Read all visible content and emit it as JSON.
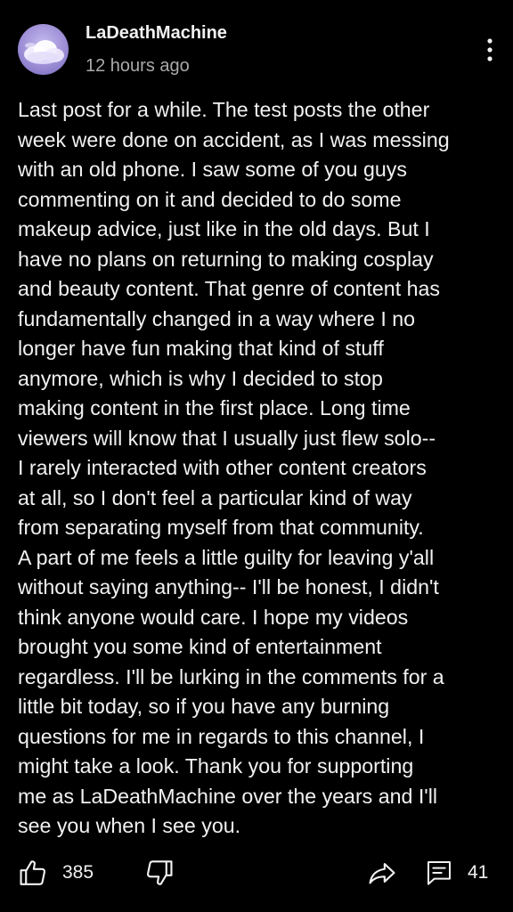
{
  "post": {
    "author": "LaDeathMachine",
    "timestamp": "12 hours ago",
    "body_lines": [
      "Last post for a while. The test posts the other",
      "week were done on accident, as I was messing",
      "with an old phone. I saw some of you guys",
      "commenting on it and decided to do some",
      "makeup advice, just like in the old days. But I",
      "have no plans on returning to making cosplay",
      "and beauty content. That genre of content has",
      "fundamentally changed in a way where I no",
      "longer have fun making that kind of stuff",
      "anymore, which is why I decided to stop",
      "making content in the first place. Long time",
      "viewers will know that I usually just flew solo--",
      "I rarely interacted with other content creators",
      "at all, so I don't feel a particular kind of way",
      "from separating myself from that community.",
      "A part of me feels a little guilty for leaving y'all",
      "without saying anything-- I'll be honest, I didn't",
      "think anyone would care. I hope my videos",
      "brought you some kind of entertainment",
      "regardless. I'll be lurking in the comments for a",
      "little bit today, so if you have any burning",
      "questions for me in regards to this channel, I",
      "might take a look.  Thank you for supporting",
      "me as LaDeathMachine over the years and I'll",
      "see you when I see you."
    ]
  },
  "actions": {
    "like_count": "385",
    "comment_count": "41"
  },
  "icons": {
    "avatar": "avatar-cloud-image",
    "more": "more-vertical-icon",
    "like": "thumbs-up-icon",
    "dislike": "thumbs-down-icon",
    "share": "share-icon",
    "comment": "comment-icon"
  },
  "colors": {
    "background": "#000000",
    "text_primary": "#f1f1f1",
    "text_secondary": "#aaaaaa",
    "avatar_sky": "#9e8fd6"
  }
}
